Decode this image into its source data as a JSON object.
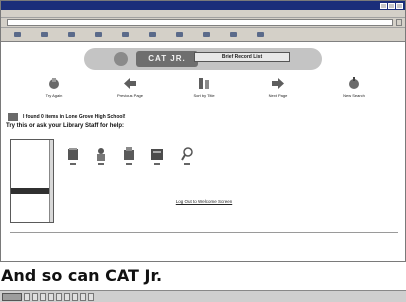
{
  "window": {
    "title": ""
  },
  "menubar": {
    "items": [
      "",
      "",
      "",
      "",
      "",
      ""
    ]
  },
  "addressbar": {
    "label": "",
    "url": "",
    "go_label": ""
  },
  "toolbar": {
    "buttons": [
      "",
      "",
      "",
      "",
      "",
      "",
      "",
      "",
      "",
      ""
    ]
  },
  "banner": {
    "logo_text": "CAT JR.",
    "record_box_label": "Brief Record List"
  },
  "nav": {
    "items": [
      {
        "label": "Try Again",
        "icon": "try-again-icon"
      },
      {
        "label": "Previous Page",
        "icon": "previous-page-arrow-icon"
      },
      {
        "label": "Sort by Title",
        "icon": "sort-by-title-icon"
      },
      {
        "label": "Next Page",
        "icon": "next-page-arrow-icon"
      },
      {
        "label": "New Search",
        "icon": "new-search-icon"
      }
    ]
  },
  "results": {
    "found_text": "I found 0 items in Lone Grove High School!",
    "advice_heading": "Try this or ask your Library Staff for help:",
    "advice_sub": "",
    "list_items": [
      "",
      "",
      "",
      "",
      "",
      "",
      "",
      "",
      "",
      "",
      "",
      "",
      ""
    ],
    "selected_index": 8
  },
  "actions": {
    "items": [
      {
        "label": "",
        "icon": "book-icon"
      },
      {
        "label": "",
        "icon": "author-icon"
      },
      {
        "label": "",
        "icon": "subject-icon"
      },
      {
        "label": "",
        "icon": "series-icon"
      },
      {
        "label": "",
        "icon": "search-all-icon"
      }
    ]
  },
  "footer": {
    "logout_link": "Log Out to Welcome Screen",
    "copyright_line1": "",
    "copyright_line2": "",
    "bottom_line1": "",
    "bottom_line2": ""
  },
  "caption": {
    "text": "And so can CAT Jr."
  },
  "taskbar": {
    "tasks": [
      "",
      "",
      "",
      "",
      "",
      "",
      "",
      "",
      ""
    ]
  },
  "colors": {
    "titlebar": "#1b2e7a",
    "chrome": "#d4d0c8",
    "banner": "#c4c4c4",
    "selected_row": "#303030"
  }
}
